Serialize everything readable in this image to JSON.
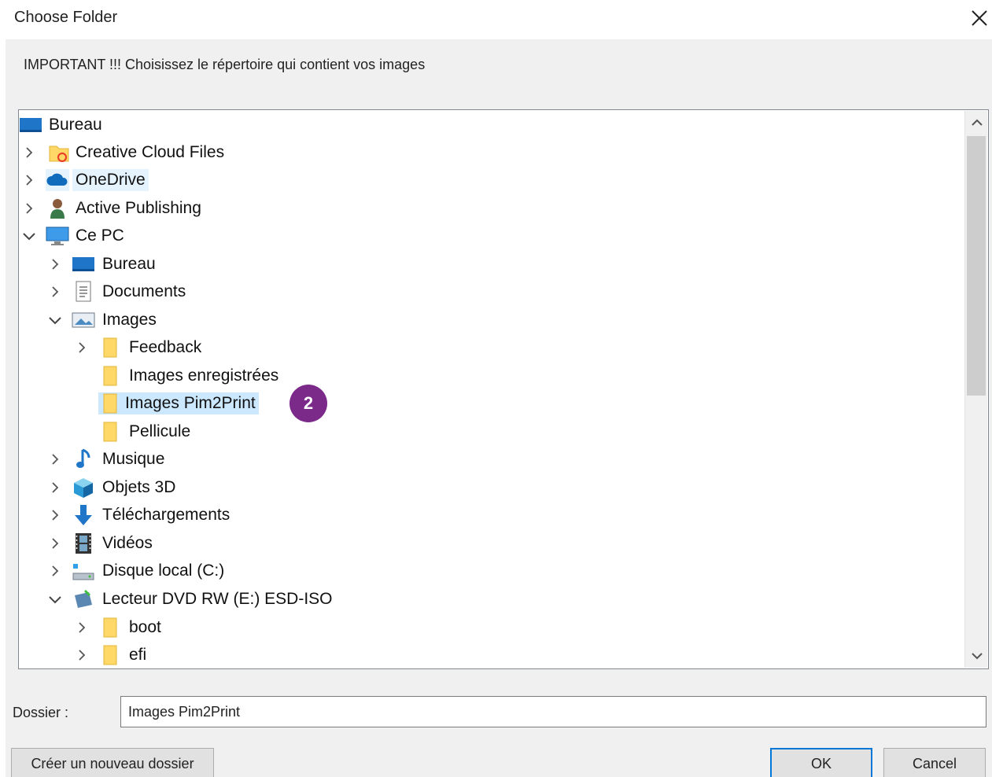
{
  "dialog": {
    "title": "Choose Folder",
    "instruction": "IMPORTANT !!! Choisissez le répertoire qui contient vos images"
  },
  "tree": {
    "items": [
      {
        "label": "Bureau",
        "icon": "desktop-icon",
        "expander": "none",
        "level": 0
      },
      {
        "label": "Creative Cloud Files",
        "icon": "creative-cloud-folder-icon",
        "expander": "collapsed",
        "level": 1
      },
      {
        "label": "OneDrive",
        "icon": "onedrive-cloud-icon",
        "expander": "collapsed",
        "level": 1
      },
      {
        "label": "Active Publishing",
        "icon": "user-icon",
        "expander": "collapsed",
        "level": 1
      },
      {
        "label": "Ce PC",
        "icon": "computer-icon",
        "expander": "expanded",
        "level": 1
      },
      {
        "label": "Bureau",
        "icon": "desktop-icon",
        "expander": "collapsed",
        "level": 2
      },
      {
        "label": "Documents",
        "icon": "documents-icon",
        "expander": "collapsed",
        "level": 2
      },
      {
        "label": "Images",
        "icon": "pictures-icon",
        "expander": "expanded",
        "level": 2
      },
      {
        "label": "Feedback",
        "icon": "folder-icon",
        "expander": "collapsed",
        "level": 3
      },
      {
        "label": "Images enregistrées",
        "icon": "folder-icon",
        "expander": "none",
        "level": 3
      },
      {
        "label": "Images Pim2Print",
        "icon": "folder-icon",
        "expander": "none",
        "level": 3,
        "selected": true
      },
      {
        "label": "Pellicule",
        "icon": "folder-icon",
        "expander": "none",
        "level": 3
      },
      {
        "label": "Musique",
        "icon": "music-note-icon",
        "expander": "collapsed",
        "level": 2
      },
      {
        "label": "Objets 3D",
        "icon": "cube-3d-icon",
        "expander": "collapsed",
        "level": 2
      },
      {
        "label": "Téléchargements",
        "icon": "download-arrow-icon",
        "expander": "collapsed",
        "level": 2
      },
      {
        "label": "Vidéos",
        "icon": "film-icon",
        "expander": "collapsed",
        "level": 2
      },
      {
        "label": "Disque local (C:)",
        "icon": "local-disk-icon",
        "expander": "collapsed",
        "level": 2
      },
      {
        "label": "Lecteur DVD RW (E:) ESD-ISO",
        "icon": "dvd-drive-icon",
        "expander": "expanded",
        "level": 2
      },
      {
        "label": "boot",
        "icon": "folder-icon",
        "expander": "collapsed",
        "level": 3
      },
      {
        "label": "efi",
        "icon": "folder-icon",
        "expander": "collapsed",
        "level": 3
      }
    ]
  },
  "annotation": {
    "step_number": "2",
    "color": "#7b2a8a"
  },
  "form": {
    "folder_label": "Dossier :",
    "folder_value": "Images Pim2Print"
  },
  "buttons": {
    "new_folder": "Créer un nouveau dossier",
    "ok": "OK",
    "cancel": "Cancel"
  },
  "colors": {
    "selection": "#cce8ff",
    "hover": "#e5f3ff",
    "accent": "#0078d7",
    "folder": "#ffd867"
  }
}
